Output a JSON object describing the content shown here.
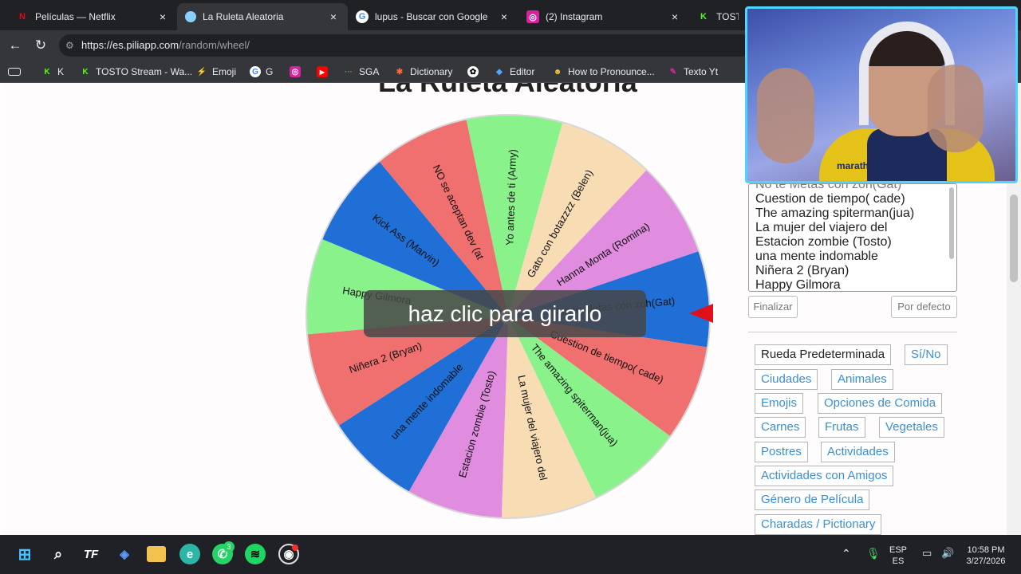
{
  "browser": {
    "tabs": [
      {
        "label": "Películas — Netflix",
        "icon": "netflix-icon",
        "color": "#e50914"
      },
      {
        "label": "La Ruleta Aleatoria",
        "icon": "piliapp-icon",
        "color": "#8ad0ff",
        "active": true
      },
      {
        "label": "lupus - Buscar con Google",
        "icon": "google-icon",
        "color": "#4285f4"
      },
      {
        "label": "(2) Instagram",
        "icon": "instagram-icon",
        "color": "#d6249f"
      },
      {
        "label": "TOSTO S",
        "icon": "kick-icon",
        "color": "#53fc18"
      }
    ],
    "url_domain": "https://es.piliapp.com",
    "url_path": "/random/wheel/",
    "bookmarks": [
      {
        "label": "K",
        "icon": "kick-icon"
      },
      {
        "label": "TOSTO Stream - Wa...",
        "icon": "kick-icon"
      },
      {
        "label": "Emoji",
        "icon": "lightning-icon"
      },
      {
        "label": "G",
        "icon": "google-icon"
      },
      {
        "label": "",
        "icon": "instagram-icon"
      },
      {
        "label": "",
        "icon": "youtube-icon"
      },
      {
        "label": "SGA",
        "icon": "sga-icon"
      },
      {
        "label": "Dictionary",
        "icon": "dictionary-icon"
      },
      {
        "label": "",
        "icon": "openai-icon"
      },
      {
        "label": "Editor",
        "icon": "editor-icon"
      },
      {
        "label": "How to Pronounce...",
        "icon": "pronounce-icon"
      },
      {
        "label": "Texto Yt",
        "icon": "texto-icon"
      }
    ]
  },
  "page": {
    "title": "La Ruleta Aleatoria",
    "spin_prompt": "haz clic para girarlo",
    "options_text": [
      "No te Metas con zoh(Gat)",
      "Cuestion de tiempo( cade)",
      "The amazing spiterman(jua)",
      "La mujer del viajero del",
      "Estacion zombie (Tosto)",
      "una mente indomable",
      "Niñera 2 (Bryan)",
      "Happy Gilmora"
    ],
    "finalize_label": "Finalizar",
    "default_label": "Por defecto",
    "presets": [
      "Rueda Predeterminada",
      "Sí/No",
      "Ciudades",
      "Animales",
      "Emojis",
      "Opciones de Comida",
      "Carnes",
      "Frutas",
      "Vegetales",
      "Postres",
      "Actividades",
      "Actividades con Amigos",
      "Género de Película",
      "Charadas / Pictionary"
    ]
  },
  "wheel": {
    "segments": [
      {
        "label": "Yo antes de ti (Army)",
        "color": "#8af28a"
      },
      {
        "label": "Gato con botazzzz (Belen)",
        "color": "#f7dcb4"
      },
      {
        "label": "Hanna Monta (Romina)",
        "color": "#e08de0"
      },
      {
        "label": "No te Metas con zoh(Gat)",
        "color": "#1f6fd6"
      },
      {
        "label": "Cuestion de tiempo( cade)",
        "color": "#f07070"
      },
      {
        "label": "The amazing spiterman(jua)",
        "color": "#8af28a"
      },
      {
        "label": "La mujer del viajero del",
        "color": "#f7dcb4"
      },
      {
        "label": "Estacion zombie (Tosto)",
        "color": "#e08de0"
      },
      {
        "label": "una mente indomable",
        "color": "#1f6fd6"
      },
      {
        "label": "Niñera 2 (Bryan)",
        "color": "#f07070"
      },
      {
        "label": "Happy Gilmora",
        "color": "#8af28a"
      },
      {
        "label": "Kick Ass (Marvin)",
        "color": "#1f6fd6"
      },
      {
        "label": "NO se aceptan dev (at",
        "color": "#f07070"
      }
    ]
  },
  "webcam": {
    "shirt_brand": "marathon"
  },
  "taskbar": {
    "lang": "ESP",
    "lang2": "ES",
    "time": "10:58 PM",
    "date": "3/27/2026",
    "whatsapp_badge": "3"
  }
}
